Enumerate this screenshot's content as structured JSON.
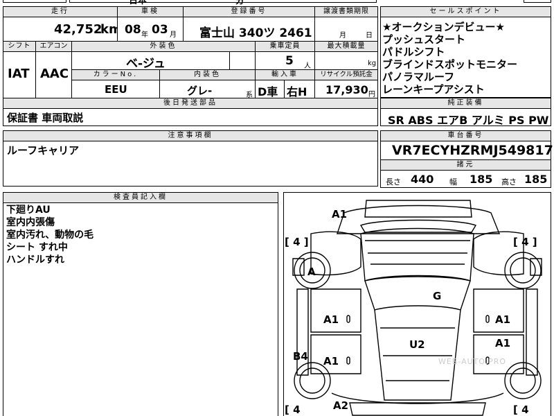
{
  "top_partial": {
    "left": "日本",
    "right": "分"
  },
  "headers": {
    "mileage": "走行",
    "inspection": "車検",
    "registration": "登録番号",
    "transfer_deadline": "譲渡書類期限",
    "shift": "シフト",
    "aircon": "エアコン",
    "exterior_color": "外装色",
    "capacity": "乗車定員",
    "max_load": "最大積載量",
    "color_no": "カラーNo.",
    "interior_color": "内装色",
    "import": "輸入車",
    "recycle": "リサイクル預託金",
    "deferred_items": "後日発送部品",
    "cautions": "注意事項欄",
    "inspector": "検査員記入欄",
    "sales_points": "セールスポイント",
    "genuine_equipment": "純正装備",
    "chassis_no": "車台番号",
    "dimensions": "諸元"
  },
  "vehicle": {
    "mileage": "42,752",
    "mileage_unit": "km",
    "inspection_year": "08",
    "inspection_year_unit": "年",
    "inspection_month": "03",
    "inspection_month_unit": "月",
    "registration": "富士山 340ツ 2461",
    "deadline_month_unit": "月",
    "deadline_day_unit": "日",
    "shift": "IAT",
    "aircon": "AAC",
    "exterior_color": "ベ-ジュ",
    "capacity": "5",
    "capacity_unit": "人",
    "max_load_unit": "kg",
    "color_no": "EEU",
    "interior_color": "グレ-",
    "interior_color_unit": "系",
    "drive_side": "D車",
    "steering": "右H",
    "recycle_fee": "17,930",
    "recycle_fee_unit": "円",
    "deferred_items": "保証書 車両取説",
    "cautions": "ルーフキャリア",
    "chassis_no": "VR7ECYHZRMJ549817"
  },
  "sales_points": [
    "★オークションデビュー★",
    "プッシュスタート",
    "パドルシフト",
    "ブラインドスポットモニター",
    "パノラマルーフ",
    "レーンキープアシスト"
  ],
  "equipment": "SR ABS エアB アルミ PS PW",
  "dimensions": {
    "length_label": "長さ",
    "length": "440",
    "width_label": "幅",
    "width": "185",
    "height_label": "高さ",
    "height": "185"
  },
  "inspector_notes": [
    "下廻りAU",
    "室内内張傷",
    "室内汚れ、動物の毛",
    "シート すれ中",
    "ハンドルすれ"
  ],
  "tire_brackets": {
    "front_left": "[ 4 ]",
    "front_right": "[ 4 ]",
    "rear_left": "[ 4",
    "rear_right": "[ 4"
  },
  "damage_marks": {
    "roof_front": "A1",
    "front_left_wheel": "A",
    "roof": "G",
    "door_front_left": "A1",
    "door_front_right": "A1",
    "door_rear_right": "A1",
    "door_rear_left": "A1",
    "interior": "U2",
    "rear_left_fender": "B4",
    "rear_bumper": "A2"
  },
  "watermark": "WEB-AUTO.PRO"
}
